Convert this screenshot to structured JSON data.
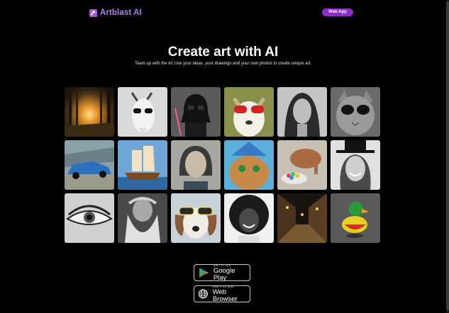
{
  "header": {
    "brand": "Artblast AI",
    "web_app_label": "Web App",
    "brand_color": "#b47cf0",
    "button_color": "#8e2cc7"
  },
  "hero": {
    "title": "Create art with AI",
    "subtitle": "Team up with the AI! Use your ideas, your drawings and your own photos to create unique art."
  },
  "gallery": {
    "tiles": [
      {
        "subject": "sunset forest"
      },
      {
        "subject": "goat with sunglasses"
      },
      {
        "subject": "darth vader toy"
      },
      {
        "subject": "dog with red sunglasses"
      },
      {
        "subject": "woman portrait"
      },
      {
        "subject": "cat with sunglasses"
      },
      {
        "subject": "blue sports car"
      },
      {
        "subject": "sailing ship"
      },
      {
        "subject": "cartoon girl portrait"
      },
      {
        "subject": "cat with blue hat"
      },
      {
        "subject": "wooden elephant with candy"
      },
      {
        "subject": "smiling woman in hat"
      },
      {
        "subject": "eye closeup"
      },
      {
        "subject": "old bearded wizard"
      },
      {
        "subject": "puppy with sunglasses"
      },
      {
        "subject": "smiling woman curly hair"
      },
      {
        "subject": "cobblestone street at night"
      },
      {
        "subject": "colorful rubber duck"
      }
    ]
  },
  "downloads": {
    "google_play": {
      "small": "GET IT ON",
      "big": "Google Play"
    },
    "web_browser": {
      "small": "Use it on your",
      "big": "Web Browser"
    }
  }
}
